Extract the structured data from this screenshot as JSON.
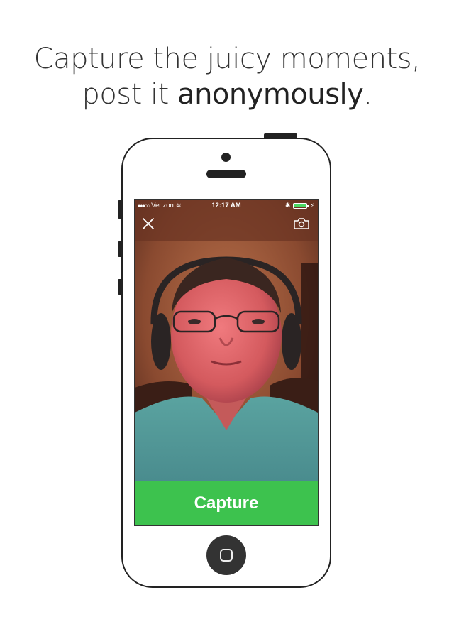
{
  "headline": {
    "line1": "Capture the juicy moments,",
    "line2_prefix": "post it ",
    "line2_bold": "anonymously",
    "line2_suffix": "."
  },
  "status_bar": {
    "carrier": "Verizon",
    "time": "12:17 AM",
    "signal_glyph": "●●●○○",
    "wifi_glyph": "≋",
    "bluetooth_glyph": "✱",
    "charging_glyph": "⚡",
    "battery_level": 1.0,
    "battery_color": "#4cd964"
  },
  "toolbar": {
    "close_icon": "close-icon",
    "switch_camera_icon": "camera-switch-icon"
  },
  "capture": {
    "label": "Capture",
    "color": "#3dc24e"
  },
  "colors": {
    "accent_green": "#3dc24e",
    "phone_outline": "#222222",
    "headline_text": "#333333"
  }
}
